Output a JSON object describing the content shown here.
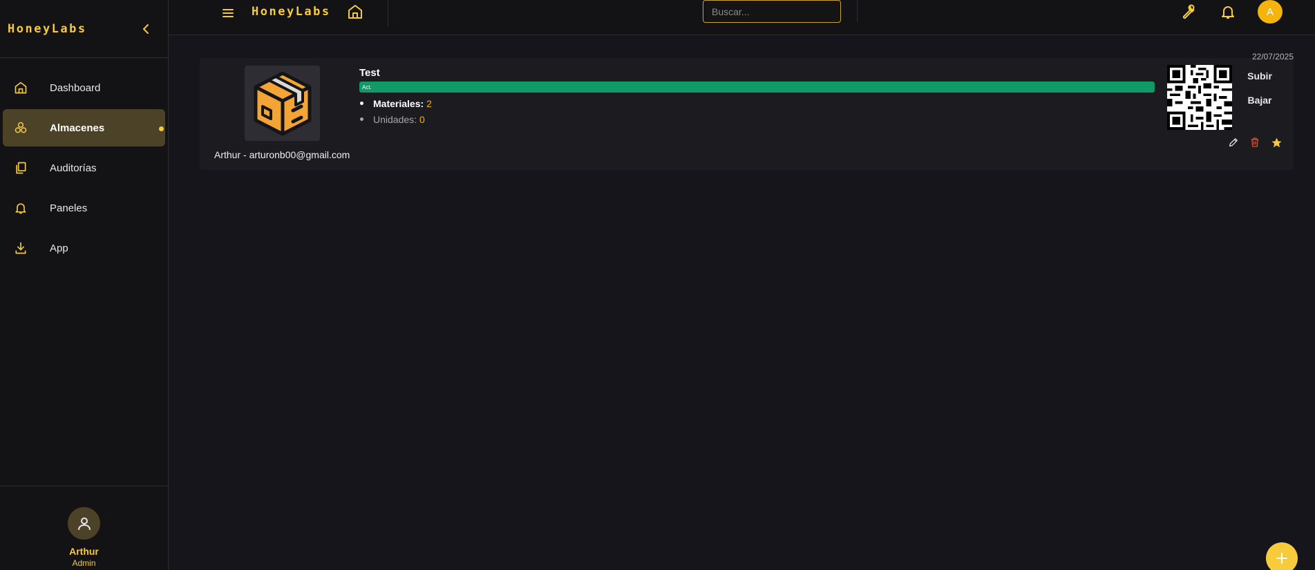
{
  "app": {
    "brand": "HoneyLabs"
  },
  "sidebar": {
    "items": [
      {
        "label": "Dashboard",
        "icon": "home-icon"
      },
      {
        "label": "Almacenes",
        "icon": "cubes-icon",
        "active": true
      },
      {
        "label": "Auditorías",
        "icon": "copy-icon"
      },
      {
        "label": "Paneles",
        "icon": "bell-icon"
      },
      {
        "label": "App",
        "icon": "download-icon"
      }
    ],
    "user": {
      "name": "Arthur",
      "role": "Admin"
    }
  },
  "topbar": {
    "brand": "HoneyLabs",
    "search_placeholder": "Buscar...",
    "avatar_initial": "A"
  },
  "card": {
    "date": "22/07/2025",
    "title": "Test",
    "progress_label": "Act.",
    "progress_fraction": 1.0,
    "materials_label": "Materiales:",
    "materials_value": "2",
    "units_label": "Unidades:",
    "units_value": "0",
    "owner": "Arthur - arturonb00@gmail.com",
    "upload_label": "Subir",
    "download_label": "Bajar"
  },
  "colors": {
    "accent": "#f7cb3c",
    "avatar": "#f5b40b",
    "progress": "#0f9a67",
    "delete": "#e0522b",
    "background": "#15151b"
  }
}
